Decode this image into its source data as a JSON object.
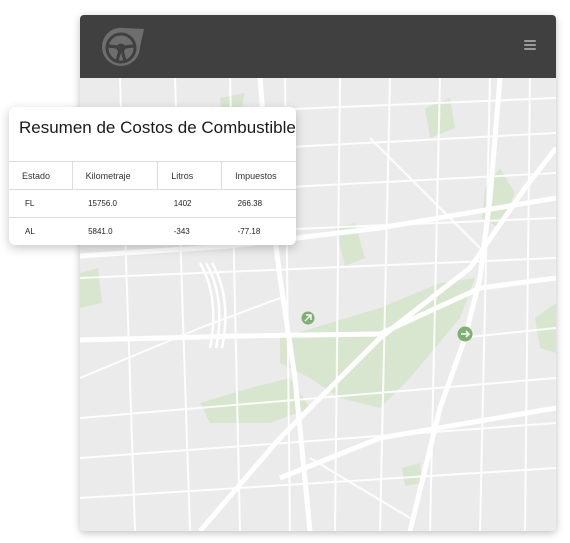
{
  "app": {
    "logo_icon": "steering-wheel-logo-icon",
    "menu_icon": "hamburger-menu-icon",
    "header_color": "#404040"
  },
  "map": {
    "park_color": "#d8e6cf",
    "road_color": "#ffffff",
    "base_color": "#ebebeb",
    "markers": [
      {
        "icon": "arrow-marker-icon",
        "color": "#7fb073"
      },
      {
        "icon": "arrow-marker-icon",
        "color": "#7fb073"
      }
    ]
  },
  "summary": {
    "title": "Resumen de Costos de Combustible",
    "columns": [
      "Estado",
      "Kilometraje",
      "Litros",
      "Impuestos"
    ],
    "rows": [
      {
        "estado": "FL",
        "kilometraje": "15756.0",
        "litros": "1402",
        "impuestos": "266.38"
      },
      {
        "estado": "AL",
        "kilometraje": "5841.0",
        "litros": "-343",
        "impuestos": "-77.18"
      }
    ]
  }
}
